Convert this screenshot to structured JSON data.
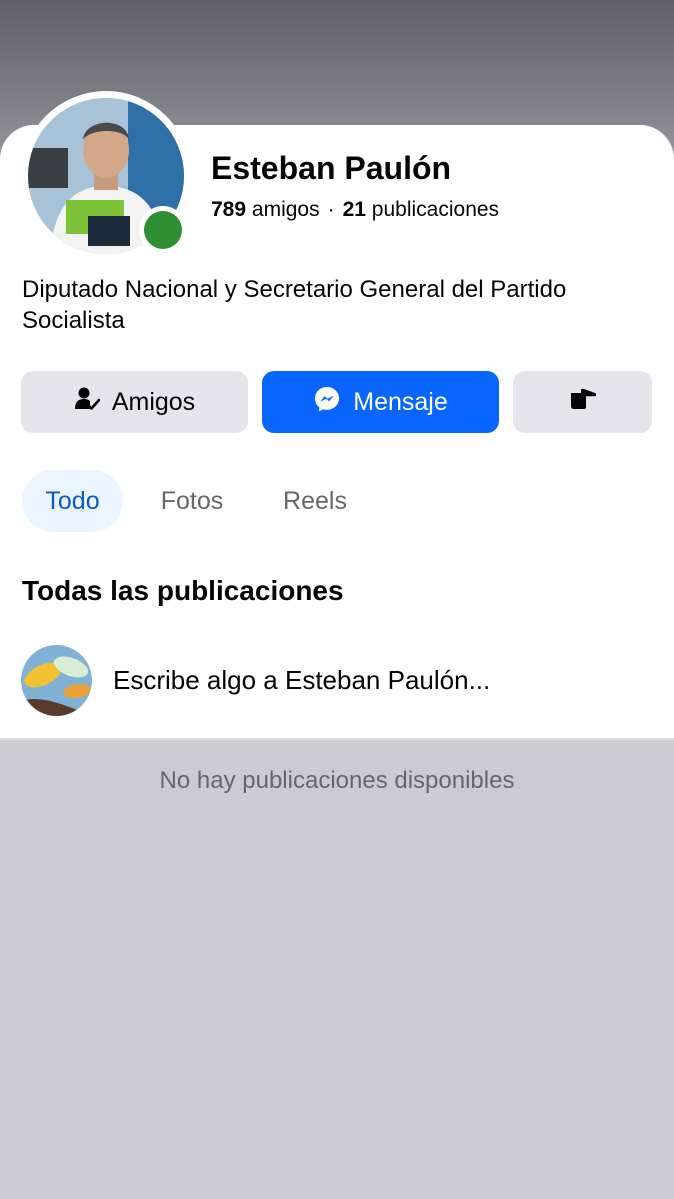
{
  "profile": {
    "name": "Esteban Paulón",
    "friends_count": "789",
    "friends_label": "amigos",
    "separator": "·",
    "posts_count": "21",
    "posts_label": "publicaciones",
    "bio": "Diputado Nacional y Secretario General del Partido Socialista",
    "online": true
  },
  "actions": {
    "friends_button": "Amigos",
    "message_button": "Mensaje",
    "poke_icon": "poke-hand-icon"
  },
  "tabs": [
    {
      "label": "Todo",
      "active": true
    },
    {
      "label": "Fotos",
      "active": false
    },
    {
      "label": "Reels",
      "active": false
    }
  ],
  "posts": {
    "section_title": "Todas las publicaciones",
    "composer_placeholder": "Escribe algo a Esteban Paulón...",
    "empty_message": "No hay publicaciones disponibles"
  },
  "colors": {
    "accent": "#0866ff",
    "active_tab_bg": "#ebf5ff",
    "active_tab_text": "#0a5bc4",
    "online": "#2d8e34",
    "button_gray": "#e4e6eb"
  }
}
